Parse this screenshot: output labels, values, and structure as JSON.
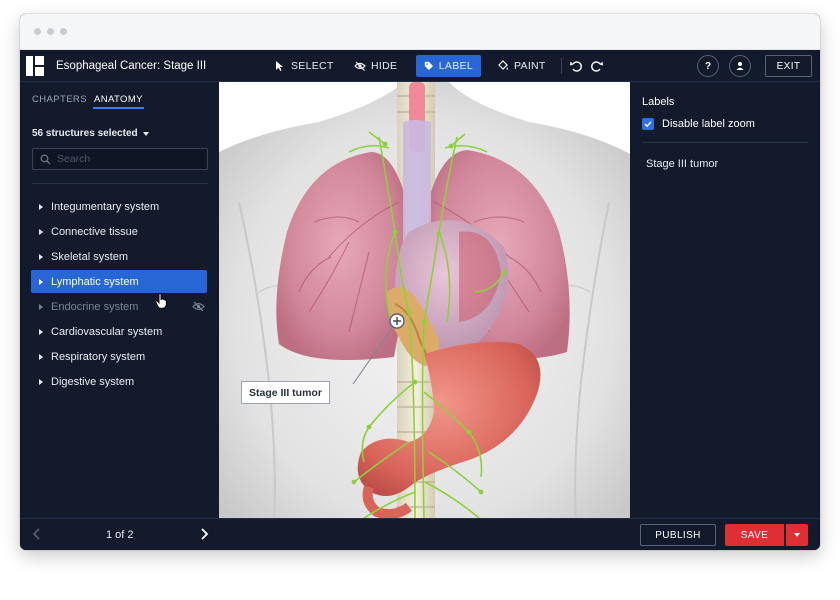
{
  "app": {
    "title": "Esophageal Cancer: Stage III"
  },
  "toolbar": {
    "tools": [
      {
        "label": "SELECT",
        "icon": "cursor-arrow-icon"
      },
      {
        "label": "HIDE",
        "icon": "eye-off-icon"
      },
      {
        "label": "LABEL",
        "icon": "tag-icon",
        "active": true
      },
      {
        "label": "PAINT",
        "icon": "paint-bucket-icon"
      }
    ],
    "help_label": "?",
    "exit_label": "EXIT"
  },
  "sidebar": {
    "tabs": [
      {
        "label": "CHAPTERS",
        "active": false
      },
      {
        "label": "ANATOMY",
        "active": true
      }
    ],
    "selection_summary": "56 structures selected",
    "search_placeholder": "Search",
    "items": [
      {
        "label": "Integumentary system",
        "state": "normal"
      },
      {
        "label": "Connective tissue",
        "state": "normal"
      },
      {
        "label": "Skeletal system",
        "state": "normal"
      },
      {
        "label": "Lymphatic system",
        "state": "selected"
      },
      {
        "label": "Endocrine system",
        "state": "hidden"
      },
      {
        "label": "Cardiovascular system",
        "state": "normal"
      },
      {
        "label": "Respiratory system",
        "state": "normal"
      },
      {
        "label": "Digestive system",
        "state": "normal"
      }
    ]
  },
  "viewport": {
    "annotation_label": "Stage III tumor"
  },
  "labels_panel": {
    "title": "Labels",
    "disable_zoom_label": "Disable label zoom",
    "disable_zoom_checked": true,
    "label_items": [
      "Stage III tumor"
    ]
  },
  "footer": {
    "page_indicator": "1 of 2",
    "publish_label": "PUBLISH",
    "save_label": "SAVE"
  },
  "colors": {
    "background": "#131a2b",
    "accent": "#2766d4",
    "save": "#df2f34"
  }
}
